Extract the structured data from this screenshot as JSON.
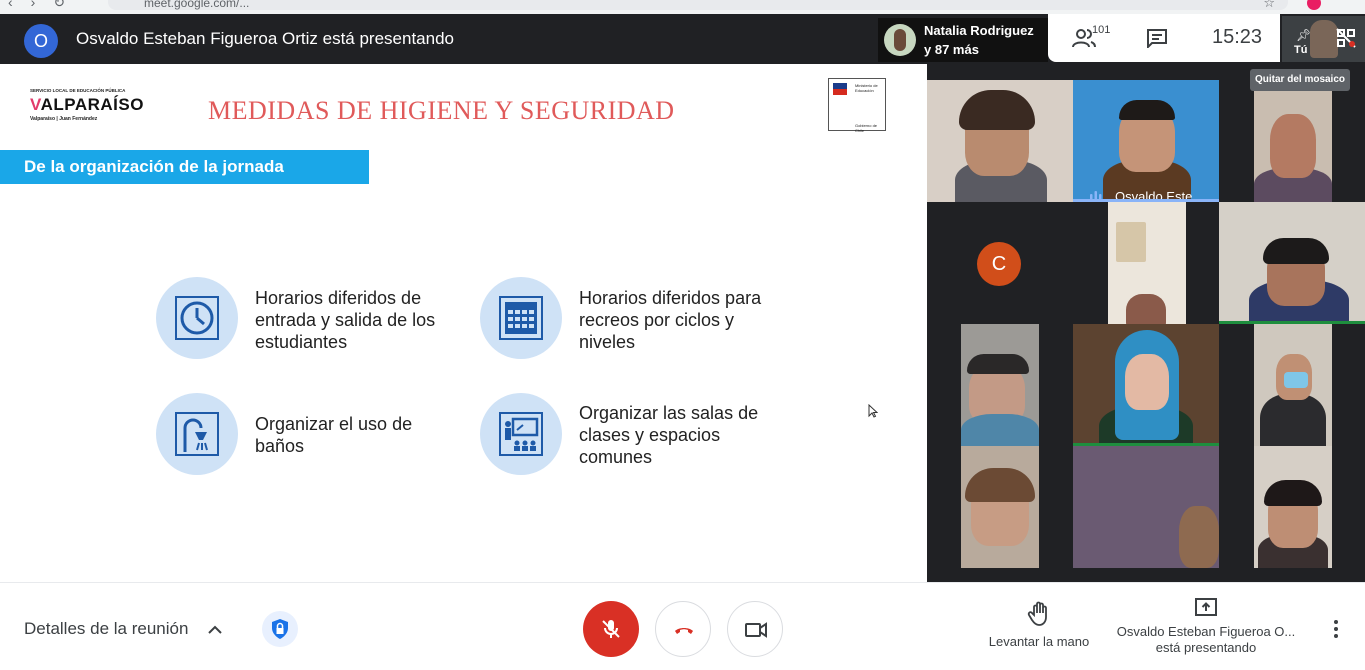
{
  "browser": {
    "url": "meet.google.com/..."
  },
  "top_bar": {
    "presenter_initial": "O",
    "presenting_text": "Osvaldo Esteban Figueroa Ortiz está presentando",
    "participant_name": "Natalia Rodriguez",
    "participant_more": "y 87 más",
    "people_count": "101",
    "clock": "15:23",
    "self_label": "Tú",
    "tooltip": "Quitar del mosaico"
  },
  "slide": {
    "logo_small": "SERVICIO LOCAL DE EDUCACIÓN PÚBLICA",
    "logo_main_initial": "V",
    "logo_main_rest": "ALPARAÍSO",
    "logo_sub": "Valparaíso | Juan Fernández",
    "title": "MEDIDAS DE HIGIENE Y SEGURIDAD",
    "ministry_text": "Ministerio de Educación",
    "government_text": "Gobierno de Chile",
    "section_header": "De la organización de la jornada",
    "items": [
      {
        "label": "Horarios diferidos de entrada y salida de los estudiantes",
        "icon": "clock-icon"
      },
      {
        "label": "Horarios diferidos para recreos por ciclos y niveles",
        "icon": "calendar-icon"
      },
      {
        "label": "Organizar el uso de baños",
        "icon": "shower-icon"
      },
      {
        "label": "Organizar las salas de clases y espacios comunes",
        "icon": "classroom-icon"
      }
    ]
  },
  "grid": {
    "speaker_name": "Osvaldo Este...",
    "initial_avatar": "C"
  },
  "bottom_bar": {
    "details_label": "Detalles de la reunión",
    "raise_hand_label": "Levantar la mano",
    "presenting_line1": "Osvaldo Esteban Figueroa O...",
    "presenting_line2": "está presentando"
  },
  "colors": {
    "accent_blue": "#1aa7e8",
    "title_red": "#e05a5a",
    "mic_red": "#d93025",
    "speaking_green": "#1e8e3e"
  }
}
